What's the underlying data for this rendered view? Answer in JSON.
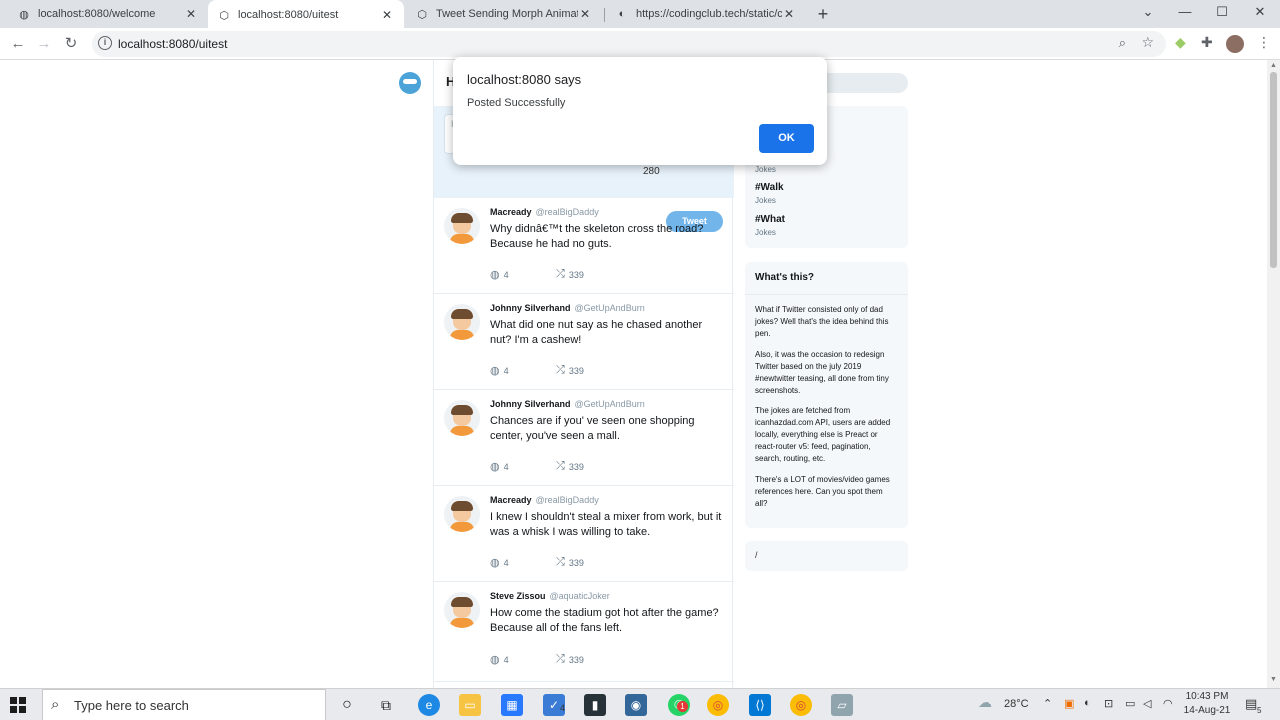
{
  "browser": {
    "tabs": [
      {
        "title": "localhost:8080/welcome",
        "active": false
      },
      {
        "title": "localhost:8080/uitest",
        "active": true
      },
      {
        "title": "Tweet Sending Morph Animation",
        "active": false
      },
      {
        "title": "https://codingclub.tech/static/co",
        "active": false
      }
    ],
    "url": "localhost:8080/uitest"
  },
  "page": {
    "header_initial": "H",
    "compose": {
      "placeholder": "H",
      "count": "280",
      "tweet_button": "Tweet"
    },
    "tweets": [
      {
        "name": "Macready",
        "handle": "@realBigDaddy",
        "text": "Why didnâ€™t the skeleton cross the road? Because he had no guts.",
        "replies": "4",
        "retweets": "339"
      },
      {
        "name": "Johnny Silverhand",
        "handle": "@GetUpAndBurn",
        "text": "What did one nut say as he chased another nut? I'm a cashew!",
        "replies": "4",
        "retweets": "339"
      },
      {
        "name": "Johnny Silverhand",
        "handle": "@GetUpAndBurn",
        "text": "Chances are if you' ve seen one shopping center, you've seen a mall.",
        "replies": "4",
        "retweets": "339"
      },
      {
        "name": "Macready",
        "handle": "@realBigDaddy",
        "text": "I knew I shouldn't steal a mixer from work, but it was a whisk I was willing to take.",
        "replies": "4",
        "retweets": "339"
      },
      {
        "name": "Steve Zissou",
        "handle": "@aquaticJoker",
        "text": "How come the stadium got hot after the game? Because all of the fans left.",
        "replies": "4",
        "retweets": "339"
      }
    ],
    "trends": [
      {
        "tag": "",
        "sub": "Jokes"
      },
      {
        "tag": "#Walk",
        "sub": "Jokes"
      },
      {
        "tag": "#What",
        "sub": "Jokes"
      }
    ],
    "about": {
      "title": "What's this?",
      "paragraphs": [
        "What if Twitter consisted only of dad jokes? Well that's the idea behind this pen.",
        "Also, it was the occasion to redesign Twitter based on the july 2019 #newtwitter teasing, all done from tiny screenshots.",
        "The jokes are fetched from icanhazdad.com API, users are added locally, everything else is Preact or react-router v5: feed, pagination, search, routing, etc.",
        "There's a LOT of movies/video games references here. Can you spot them all?"
      ]
    },
    "footer_text": "/"
  },
  "dialog": {
    "title": "localhost:8080 says",
    "message": "Posted Successfully",
    "ok_label": "OK"
  },
  "taskbar": {
    "search_placeholder": "Type here to search",
    "temperature": "28°C",
    "time": "10:43 PM",
    "date": "14-Aug-21",
    "badge_tasks": "4",
    "badge_whatsapp": "1",
    "badge_notifications": "5"
  },
  "colors": {
    "accent_blue": "#1a73e8",
    "tweet_button": "#71b5ea",
    "compose_bg": "#e8f2fa"
  }
}
